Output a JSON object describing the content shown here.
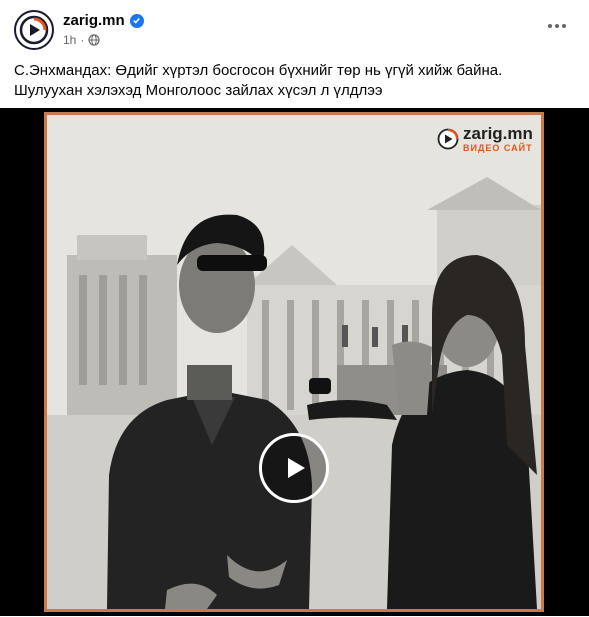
{
  "post": {
    "page_name": "zarig.mn",
    "timestamp": "1h",
    "separator": "·",
    "caption": "С.Энхмандах: Өдийг хүртэл босгосон бүхнийг төр нь үгүй хийж байна. Шулуухан хэлэхэд Монголоос зайлах хүсэл л үлдлээ"
  },
  "video": {
    "watermark_name": "zarig.mn",
    "watermark_sub": "ВИДЕО САЙТ"
  },
  "icons": {
    "avatar": "play-logo-icon",
    "verified": "verified-badge-icon",
    "privacy": "globe-icon",
    "more": "more-options-icon",
    "play": "play-icon"
  },
  "colors": {
    "verified": "#1877f2",
    "frame_border": "#c97a4a",
    "logo_accent": "#e0561c"
  }
}
